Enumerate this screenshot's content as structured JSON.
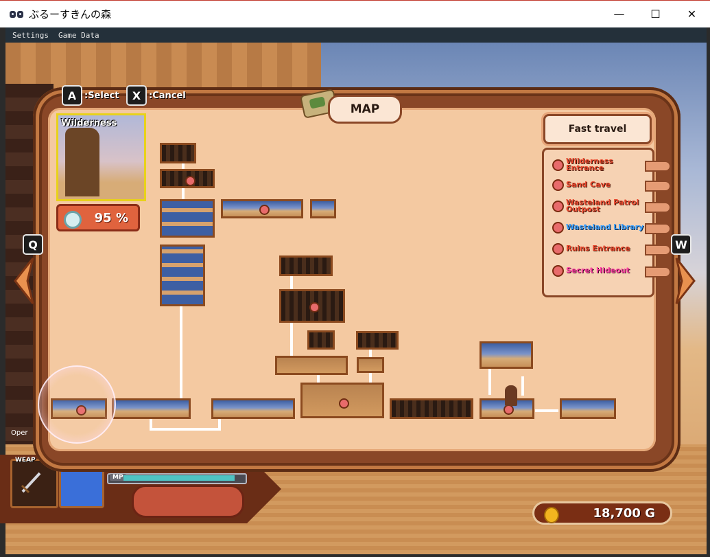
{
  "window": {
    "title": "ぶるーすきんの森",
    "controls": {
      "minimize": "—",
      "maximize": "☐",
      "close": "✕"
    }
  },
  "menu": [
    "Settings",
    "Game Data"
  ],
  "controls_hint": {
    "select_key": "A",
    "select_label": ":Select",
    "cancel_key": "X",
    "cancel_label": ":Cancel",
    "prev_key": "Q",
    "next_key": "W"
  },
  "map": {
    "title": "MAP",
    "current_area": "Wilderness",
    "exploration": "95",
    "exploration_unit": "%"
  },
  "fast_travel": {
    "header": "Fast travel",
    "items": [
      {
        "line1": "Wilderness",
        "line2": "Entrance",
        "style": "normal"
      },
      {
        "line1": "Sand Cave",
        "line2": "",
        "style": "normal"
      },
      {
        "line1": "Wasteland Patrol",
        "line2": "Outpost",
        "style": "normal"
      },
      {
        "line1": "Wasteland Library",
        "line2": "",
        "style": "blue"
      },
      {
        "line1": "Ruins Entrance",
        "line2": "",
        "style": "normal"
      },
      {
        "line1": "Secret Hideout",
        "line2": "",
        "style": "pink"
      }
    ]
  },
  "hud": {
    "weapon_label": "WEAP",
    "mp_label": "MP",
    "mp_level": 0.95,
    "gold": "18,700",
    "gold_unit": "G",
    "edge_text": "Oper"
  },
  "colors": {
    "frame": "#8a4727",
    "parchment": "#f4c9a1",
    "travel_normal": "#e8472d",
    "travel_blue": "#3aa0ff",
    "travel_pink": "#ff45a3",
    "mp": "#4fc3c4",
    "preview_border": "#e8d21a"
  }
}
